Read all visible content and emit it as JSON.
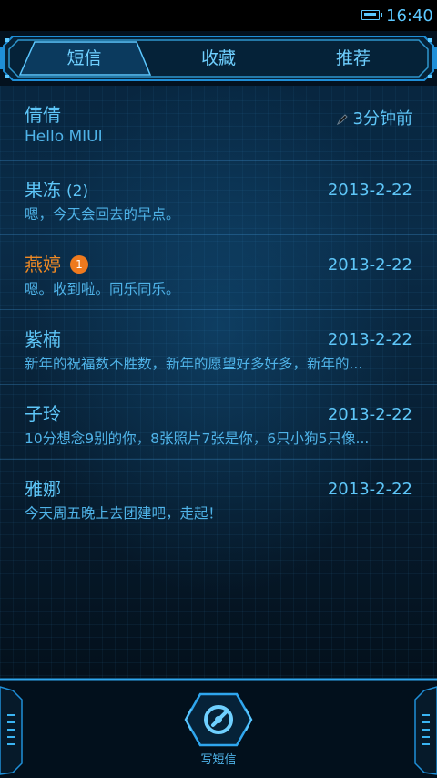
{
  "status_bar": {
    "time": "16:40",
    "battery_icon": "battery-icon"
  },
  "tabs": [
    {
      "label": "短信"
    },
    {
      "label": "收藏"
    },
    {
      "label": "推荐"
    }
  ],
  "conversations": [
    {
      "name": "倩倩",
      "count": "",
      "badge": "",
      "date": "3分钟前",
      "preview": "Hello MIUI",
      "draft": true
    },
    {
      "name": "果冻",
      "count": "(2)",
      "badge": "",
      "date": "2013-2-22",
      "preview": "嗯，今天会回去的早点。"
    },
    {
      "name": "燕婷",
      "count": "",
      "badge": "1",
      "date": "2013-2-22",
      "preview": "嗯。收到啦。同乐同乐。"
    },
    {
      "name": "紫楠",
      "count": "",
      "badge": "",
      "date": "2013-2-22",
      "preview": "新年的祝福数不胜数，新年的愿望好多好多，新年的..."
    },
    {
      "name": "子玲",
      "count": "",
      "badge": "",
      "date": "2013-2-22",
      "preview": "10分想念9别的你，8张照片7张是你，6只小狗5只像..."
    },
    {
      "name": "雅娜",
      "count": "",
      "badge": "",
      "date": "2013-2-22",
      "preview": "今天周五晚上去团建吧，走起！"
    }
  ],
  "bottom_bar": {
    "compose_label": "写短信"
  },
  "colors": {
    "accent": "#5ec6f8",
    "unread": "#f08a24",
    "badge": "#ef7a1e",
    "background": "#04101c"
  }
}
